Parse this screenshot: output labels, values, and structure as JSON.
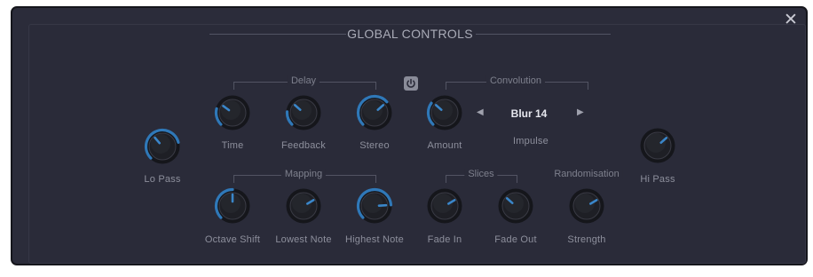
{
  "title": "GLOBAL CONTROLS",
  "close_glyph": "✕",
  "groups": {
    "delay": "Delay",
    "convolution": "Convolution",
    "mapping": "Mapping",
    "slices": "Slices",
    "randomisation": "Randomisation"
  },
  "knobs": [
    {
      "id": "lo-pass",
      "label": "Lo Pass",
      "value": 0.35,
      "ring": 0.78
    },
    {
      "id": "time",
      "label": "Time",
      "value": 0.3,
      "ring": 0.22
    },
    {
      "id": "feedback",
      "label": "Feedback",
      "value": 0.32,
      "ring": 0.18
    },
    {
      "id": "stereo",
      "label": "Stereo",
      "value": 0.68,
      "ring": 0.68
    },
    {
      "id": "amount",
      "label": "Amount",
      "value": 0.32,
      "ring": 0.3
    },
    {
      "id": "hi-pass",
      "label": "Hi Pass",
      "value": 0.68,
      "ring": 0
    },
    {
      "id": "octave-shift",
      "label": "Octave Shift",
      "value": 0.5,
      "ring": 0.5
    },
    {
      "id": "lowest-note",
      "label": "Lowest Note",
      "value": 0.72,
      "ring": 0
    },
    {
      "id": "highest-note",
      "label": "Highest Note",
      "value": 0.82,
      "ring": 0.82
    },
    {
      "id": "fade-in",
      "label": "Fade In",
      "value": 0.72,
      "ring": 0
    },
    {
      "id": "fade-out",
      "label": "Fade Out",
      "value": 0.32,
      "ring": 0
    },
    {
      "id": "strength",
      "label": "Strength",
      "value": 0.72,
      "ring": 0
    }
  ],
  "impulse": {
    "label": "Impulse",
    "value": "Blur 14",
    "prev_glyph": "◀",
    "next_glyph": "▶"
  },
  "power_icon": "power-icon",
  "colors": {
    "accent": "#2f78b8",
    "panel_bg": "#2a2b39",
    "knob_face": "#1e1f25",
    "indicator": "#3a86c9"
  }
}
